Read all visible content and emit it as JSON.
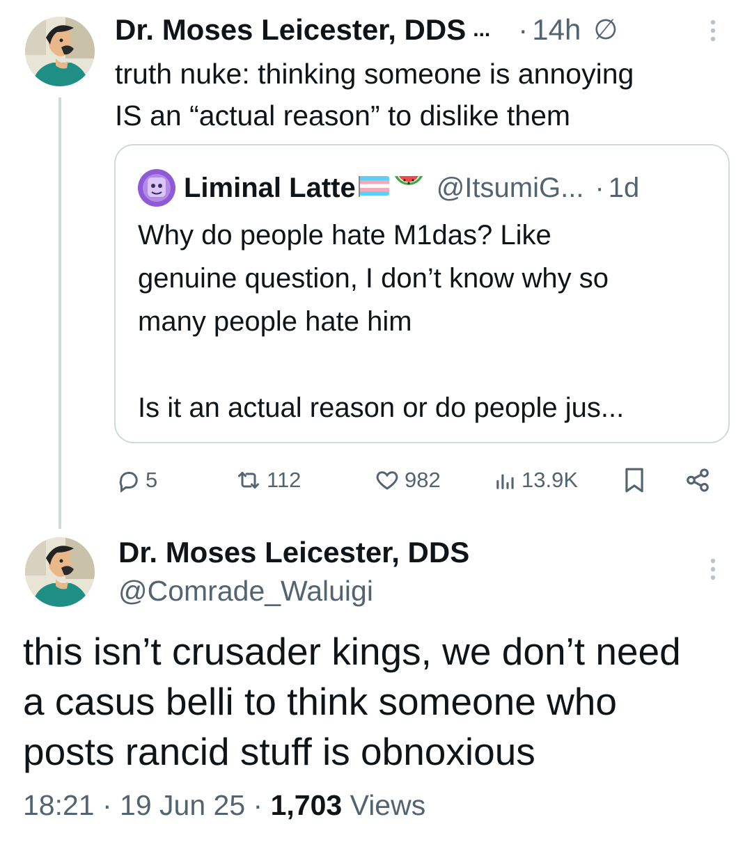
{
  "parent_tweet": {
    "display_name": "Dr. Moses Leicester, DDS",
    "name_truncation": "...",
    "time_sep": "·",
    "time": "14h",
    "status_symbol": "∅",
    "text": "truth nuke: thinking someone is annoying\nIS an “actual reason” to dislike them",
    "more_icon": "more-vertical-icon",
    "quote": {
      "display_name": "Liminal Latte",
      "name_emojis": [
        "transgender-flag",
        "watermelon"
      ],
      "handle": "@ItsumiG...",
      "time_sep": "·",
      "time": "1d",
      "text": "Why do people hate M1das? Like\ngenuine question, I don’t know why so\nmany people hate him\n\nIs it an actual reason or do people jus..."
    },
    "actions": {
      "replies": "5",
      "retweets": "112",
      "likes": "982",
      "views": "13.9K"
    }
  },
  "main_tweet": {
    "display_name": "Dr. Moses Leicester, DDS",
    "handle": "@Comrade_Waluigi",
    "text": "this isn’t crusader kings, we don’t need\na casus belli to think someone who\nposts rancid stuff is obnoxious",
    "time": "18:21",
    "sep1": " · ",
    "date": "19 Jun 25",
    "sep2": " · ",
    "views_count": "1,703",
    "views_label": " Views"
  },
  "colors": {
    "text": "#0f1419",
    "muted": "#536471",
    "border": "#cfd9de"
  }
}
